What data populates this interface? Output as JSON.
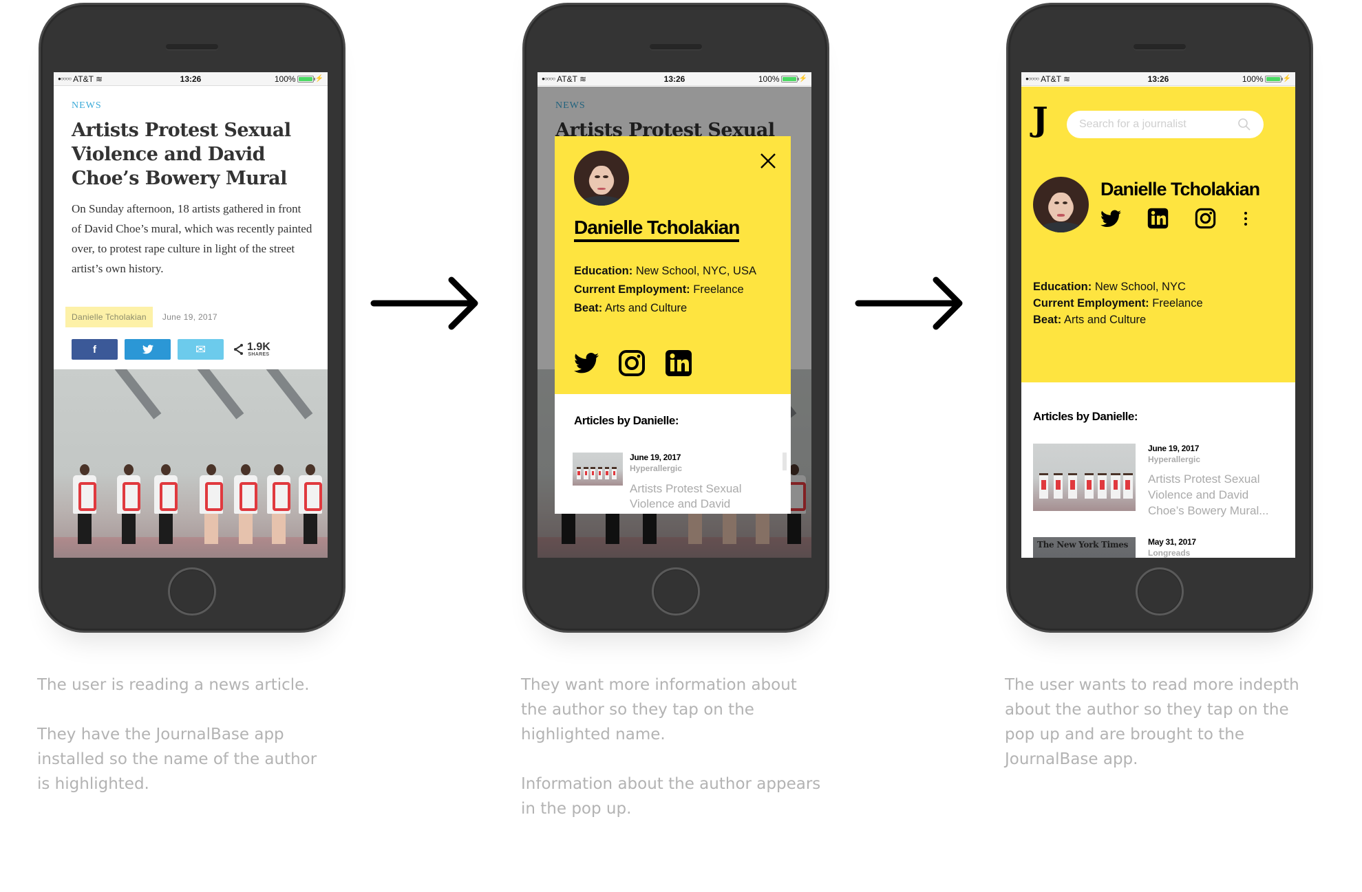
{
  "statusbar": {
    "carrier": "AT&T",
    "signal_dots": "●○○○○",
    "time": "13:26",
    "battery": "100%",
    "battery_level": 1.0
  },
  "colors": {
    "accent_yellow": "#fee440",
    "highlight_yellow": "#fdf1a8",
    "news_blue": "#3aaad8",
    "facebook": "#3b5998",
    "twitter": "#2b97d6",
    "email": "#6ccbec",
    "caption_gray": "#b3b3b3"
  },
  "screen1": {
    "kicker": "NEWS",
    "headline": "Artists Protest Sexual Violence and David Choe’s Bowery Mural",
    "body": "On Sunday afternoon, 18 artists gathered in front of David Choe’s mural, which was recently painted over, to protest rape culture in light of the street artist’s own history.",
    "author": "Danielle Tcholakian",
    "date": "June 19, 2017",
    "share_buttons": [
      {
        "icon": "facebook-icon",
        "glyph": "f"
      },
      {
        "icon": "twitter-icon",
        "glyph": ""
      },
      {
        "icon": "email-icon",
        "glyph": "✉"
      }
    ],
    "share_count": "1.9K",
    "share_label": "SHARES"
  },
  "screen2": {
    "kicker": "NEWS",
    "headline_peek": "Artists Protest Sexual",
    "popup": {
      "name": "Danielle Tcholakian",
      "education_label": "Education:",
      "education_value": "New School, NYC, USA",
      "employment_label": "Current Employment:",
      "employment_value": "Freelance",
      "beat_label": "Beat:",
      "beat_value": "Arts and Culture",
      "socials": [
        "twitter-icon",
        "instagram-icon",
        "linkedin-icon"
      ],
      "articles_heading": "Articles by Danielle:",
      "articles": [
        {
          "date": "June 19, 2017",
          "source": "Hyperallergic",
          "title": "Artists Protest Sexual Violence and David"
        }
      ]
    }
  },
  "screen3": {
    "logo": "J",
    "search_placeholder": "Search for a journalist",
    "name": "Danielle Tcholakian",
    "socials": [
      "twitter-icon",
      "linkedin-icon",
      "instagram-icon",
      "more-icon"
    ],
    "education_label": "Education:",
    "education_value": "New School, NYC",
    "employment_label": "Current Employment:",
    "employment_value": "Freelance",
    "beat_label": "Beat:",
    "beat_value": "Arts and Culture",
    "articles_heading": "Articles by Danielle:",
    "articles": [
      {
        "date": "June 19, 2017",
        "source": "Hyperallergic",
        "title": "Artists Protest Sexual Violence and David Choe’s Bowery Mural..."
      },
      {
        "date": "May 31, 2017",
        "source": "Longreads",
        "thumb_text": "The New York Times"
      }
    ]
  },
  "captions": [
    [
      "The user is reading a news article.",
      "They have the JournalBase app installed so the name of the author is highlighted."
    ],
    [
      "They want more information about the author so they tap on the highlighted name.",
      "Information about the author appears in the pop up."
    ],
    [
      "The user wants to read more indepth about the author so they tap on the pop up and are brought to the JournalBase app."
    ]
  ]
}
